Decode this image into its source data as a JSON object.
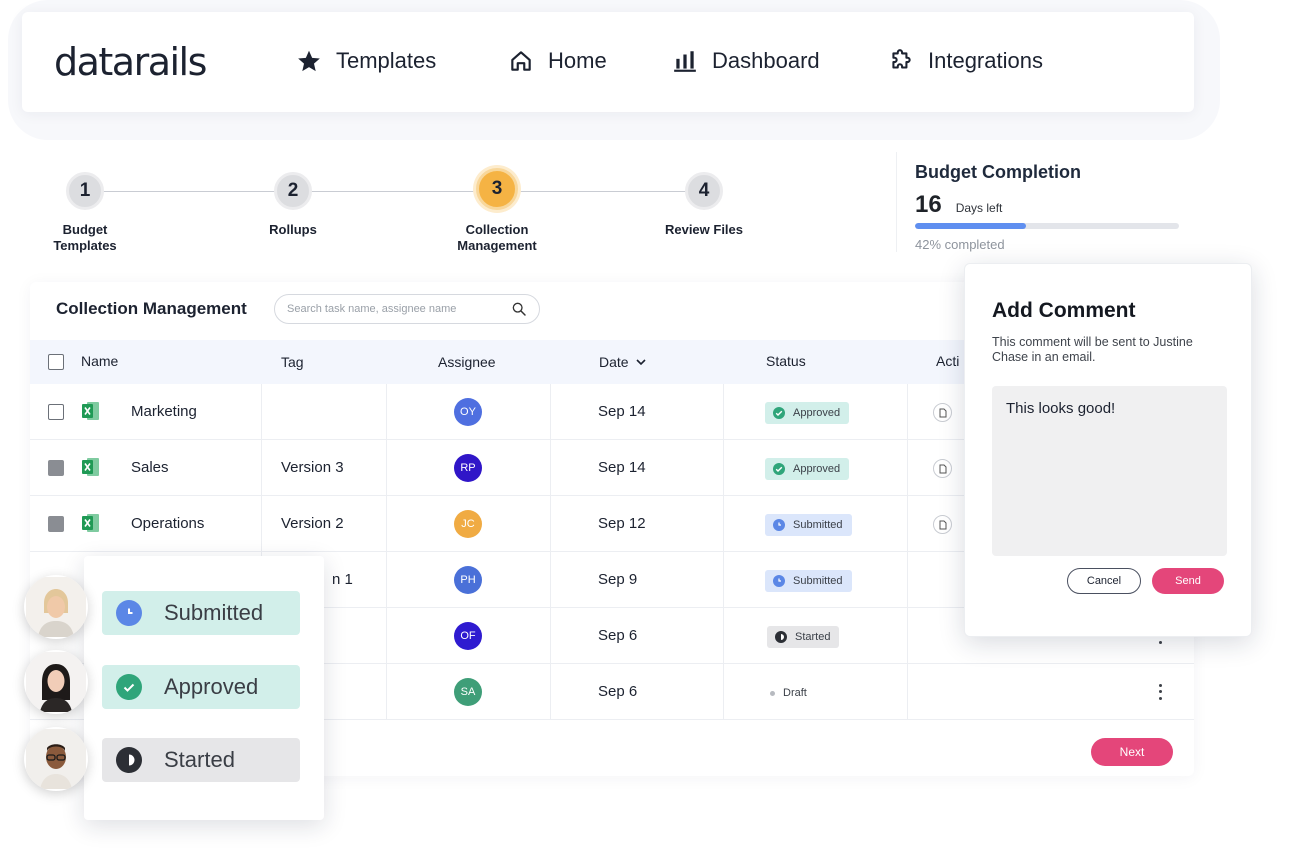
{
  "brand": {
    "logo_text": "datarails"
  },
  "nav": {
    "items": [
      {
        "label": "Templates",
        "icon": "star-icon"
      },
      {
        "label": "Home",
        "icon": "home-icon"
      },
      {
        "label": "Dashboard",
        "icon": "bar-chart-icon"
      },
      {
        "label": "Integrations",
        "icon": "puzzle-icon"
      }
    ]
  },
  "stepper": {
    "steps": [
      {
        "number": "1",
        "label": "Budget Templates",
        "active": false
      },
      {
        "number": "2",
        "label": "Rollups",
        "active": false
      },
      {
        "number": "3",
        "label": "Collection Management",
        "active": true
      },
      {
        "number": "4",
        "label": "Review Files",
        "active": false
      }
    ]
  },
  "budget": {
    "title": "Budget Completion",
    "days_number": "16",
    "days_label": "Days left",
    "progress": 0.42,
    "progress_text": "42% completed"
  },
  "collection": {
    "title": "Collection Management",
    "search_placeholder": "Search task name, assignee name",
    "columns": {
      "name": "Name",
      "tag": "Tag",
      "assignee": "Assignee",
      "date": "Date",
      "status": "Status",
      "actions": "Acti"
    },
    "rows": [
      {
        "name": "Marketing",
        "tag": "",
        "assignee": "OY",
        "date": "Sep 14",
        "status": "Approved"
      },
      {
        "name": "Sales",
        "tag": "Version 3",
        "assignee": "RP",
        "date": "Sep 14",
        "status": "Approved"
      },
      {
        "name": "Operations",
        "tag": "Version 2",
        "assignee": "JC",
        "date": "Sep 12",
        "status": "Submitted"
      },
      {
        "name": "",
        "tag": "n 1",
        "assignee": "PH",
        "date": "Sep 9",
        "status": "Submitted"
      },
      {
        "name": "",
        "tag": "",
        "assignee": "OF",
        "date": "Sep 6",
        "status": "Started"
      },
      {
        "name": "",
        "tag": "",
        "assignee": "SA",
        "date": "Sep 6",
        "status": "Draft"
      }
    ],
    "next_label": "Next"
  },
  "comment_modal": {
    "title": "Add Comment",
    "subtitle": "This comment will be sent to Justine Chase in an email.",
    "text": "This looks good!",
    "cancel_label": "Cancel",
    "send_label": "Send"
  },
  "legend": {
    "items": [
      {
        "label": "Submitted"
      },
      {
        "label": "Approved"
      },
      {
        "label": "Started"
      }
    ]
  },
  "colors": {
    "accent_pink": "#e4467a",
    "progress_blue": "#5f8ff0",
    "step_active": "#f5b344",
    "approved_bg": "#d2efea",
    "submitted_bg": "#dbe6fb",
    "started_bg": "#e6e6e8",
    "avatar_oy": "#4f6fe0",
    "avatar_rp": "#3016c8",
    "avatar_jc": "#f0ab43",
    "avatar_ph": "#4a70d8",
    "avatar_of": "#2f1bd0",
    "avatar_sa": "#3f9e78"
  }
}
